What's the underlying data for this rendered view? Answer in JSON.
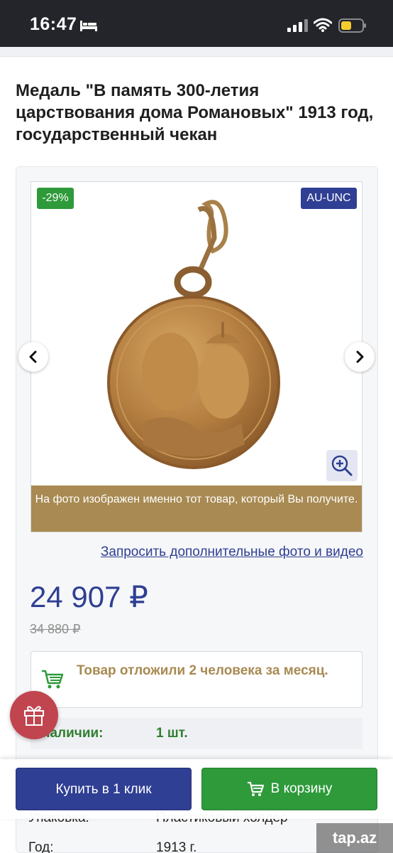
{
  "status_bar": {
    "time": "16:47"
  },
  "product": {
    "title": "Медаль \"В память 300-летия царствования дома Романовых\" 1913 год, государственный чекан",
    "discount_badge": "-29%",
    "grade_badge": "AU-UNC",
    "photo_caption": "На фото изображен именно тот товар, который Вы получите.",
    "request_link": "Запросить дополнительные фото и видео",
    "price": "24 907 ₽",
    "old_price": "34 880 ₽",
    "notice": "Товар отложили 2 человека за месяц."
  },
  "specs": {
    "stock_label": "наличии:",
    "stock_value": "1 шт.",
    "pack_label": "Упаковка:",
    "pack_value": "Пластиковый холдер",
    "year_label": "Год:",
    "year_value": "1913 г."
  },
  "actions": {
    "buy_one_click": "Купить в 1 клик",
    "add_to_cart": "В корзину"
  },
  "watermark": "tap.az",
  "colors": {
    "accent_blue": "#2f3f93",
    "accent_green": "#2e9a3a",
    "gold": "#a88a52",
    "gift_red": "#c0454f"
  },
  "icons": [
    "bed-icon",
    "signal-icon",
    "wifi-icon",
    "battery-icon",
    "chevron-left-icon",
    "chevron-right-icon",
    "zoom-in-icon",
    "cart-icon",
    "gift-icon"
  ]
}
